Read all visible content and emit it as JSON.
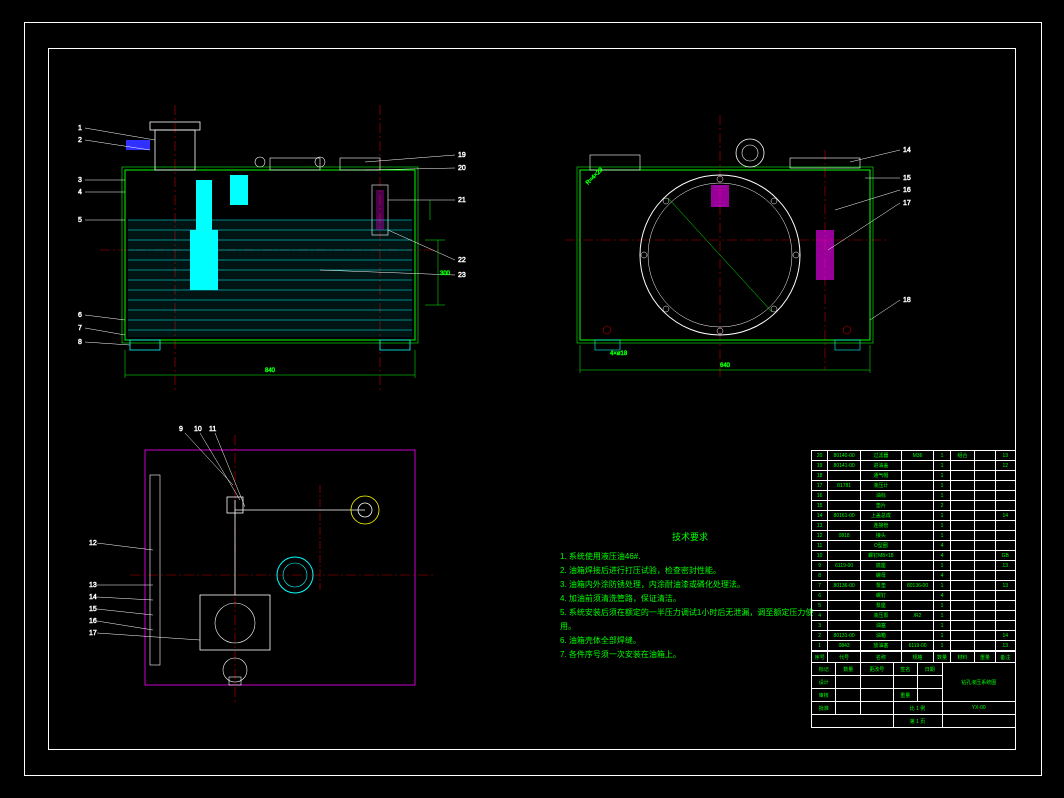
{
  "notes": {
    "title": "技术要求",
    "lines": [
      "1. 系统使用液压油46#.",
      "2. 油箱焊接后进行打压试验，检查密封性能。",
      "3. 油箱内外涂防锈处理，内涂耐油漆或磷化处理法。",
      "4. 加油前须清洗管路，保证清洁。",
      "5. 系统安装后须在额定的一半压力调试1小时后无泄漏，调至额定压力使用。",
      "6. 油箱壳体全部焊缝。",
      "7. 各件序号须一次安装在油箱上。"
    ]
  },
  "bom_header": [
    "序号",
    "代号",
    "名称",
    "规格",
    "数量",
    "材料",
    "重量",
    "备注"
  ],
  "bom_rows": [
    [
      "20",
      "80140-00",
      "过滤器",
      "M36",
      "1",
      "组合",
      "",
      "13"
    ],
    [
      "19",
      "80141-00",
      "进油盖",
      "",
      "1",
      "",
      "",
      "12"
    ],
    [
      "18",
      "",
      "通气帽",
      "",
      "1",
      "",
      "",
      ""
    ],
    [
      "17",
      "81781",
      "液压计",
      "",
      "1",
      "",
      "",
      ""
    ],
    [
      "16",
      "",
      "油标",
      "",
      "1",
      "",
      "",
      ""
    ],
    [
      "15",
      "",
      "垫片",
      "",
      "2",
      "",
      "",
      ""
    ],
    [
      "14",
      "80161-00",
      "上盖总成",
      "",
      "1",
      "",
      "",
      "14"
    ],
    [
      "13",
      "",
      "连接管",
      "",
      "1",
      "",
      "",
      ""
    ],
    [
      "12",
      "0818",
      "接头",
      "",
      "1",
      "",
      "",
      ""
    ],
    [
      "11",
      "",
      "O型圈",
      "",
      "4",
      "",
      "",
      ""
    ],
    [
      "10",
      "",
      "螺钉M8×18",
      "",
      "4",
      "",
      "",
      "GB"
    ],
    [
      "9",
      "6119-00",
      "底座",
      "",
      "1",
      "",
      "",
      "13"
    ],
    [
      "8",
      "",
      "螺母",
      "",
      "4",
      "",
      "",
      ""
    ],
    [
      "7",
      "80136-00",
      "泵垫",
      "80136-00",
      "1",
      "",
      "",
      "13"
    ],
    [
      "6",
      "",
      "螺钉",
      "",
      "4",
      "",
      "",
      ""
    ],
    [
      "5",
      "",
      "泵座",
      "",
      "1",
      "",
      "",
      ""
    ],
    [
      "4",
      "",
      "液压泵",
      "/R2",
      "1",
      "",
      "",
      ""
    ],
    [
      "3",
      "",
      "油塞",
      "",
      "1",
      "",
      "",
      ""
    ],
    [
      "2",
      "80131-00",
      "油箱",
      "",
      "1",
      "",
      "",
      "14"
    ],
    [
      "1",
      "0843",
      "放油塞",
      "6119-00",
      "1",
      "",
      "",
      "13"
    ]
  ],
  "title_block": {
    "drawing_name": "钻孔液压系统图",
    "drawing_no": "YX-00",
    "scale": "比 1 例",
    "sheet": "第 1 页",
    "design": "设计",
    "check": "审核",
    "approve": "批准",
    "mark": "标记",
    "qty": "数量",
    "change": "更改号",
    "sign": "签名",
    "date": "日期",
    "weight": "重量"
  },
  "balloons_v1": [
    "1",
    "2",
    "3",
    "4",
    "5",
    "6",
    "7",
    "8",
    "19",
    "20",
    "21",
    "22",
    "23"
  ],
  "balloons_v2": [
    "14",
    "15",
    "16",
    "17",
    "18"
  ],
  "balloons_v3": [
    "9",
    "10",
    "11",
    "12",
    "13",
    "14",
    "15",
    "16",
    "17"
  ]
}
